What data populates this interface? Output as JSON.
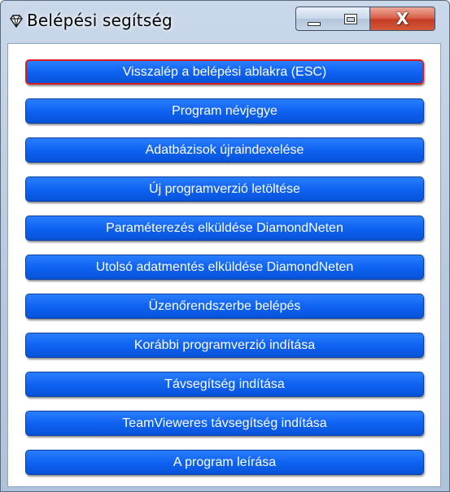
{
  "window": {
    "title": "Belépési segítség",
    "icon": "diamond-icon",
    "controls": {
      "minimize_icon": "minimize-icon",
      "maximize_icon": "maximize-icon",
      "close_icon": "close-icon",
      "close_glyph": "X"
    }
  },
  "colors": {
    "button_fill": "#1567f5",
    "button_text": "#ffffff",
    "focus_border": "#d81e1e",
    "close_button": "#c94a30"
  },
  "buttons": [
    {
      "label": "Visszalép a belépési ablakra (ESC)",
      "focused": true
    },
    {
      "label": "Program névjegye"
    },
    {
      "label": "Adatbázisok újraindexelése"
    },
    {
      "label": "Új programverzió letöltése"
    },
    {
      "label": "Paraméterezés elküldése DiamondNeten"
    },
    {
      "label": "Utolsó adatmentés elküldése DiamondNeten"
    },
    {
      "label": "Üzenőrendszerbe belépés"
    },
    {
      "label": "Korábbi programverzió indítása"
    },
    {
      "label": "Távsegítség indítása"
    },
    {
      "label": "TeamVieweres távsegítség indítása"
    },
    {
      "label": "A program leírása"
    }
  ]
}
